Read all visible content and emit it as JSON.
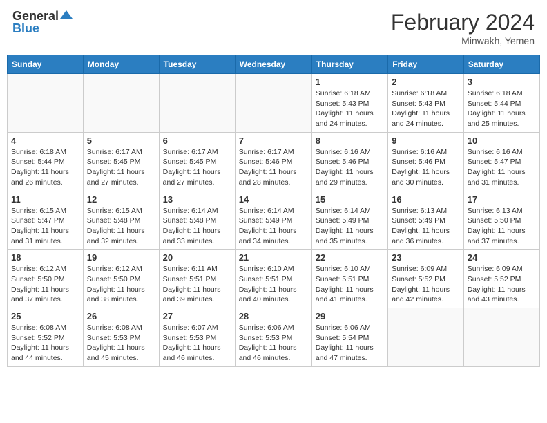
{
  "header": {
    "logo_general": "General",
    "logo_blue": "Blue",
    "month_year": "February 2024",
    "location": "Minwakh, Yemen"
  },
  "weekdays": [
    "Sunday",
    "Monday",
    "Tuesday",
    "Wednesday",
    "Thursday",
    "Friday",
    "Saturday"
  ],
  "weeks": [
    [
      {
        "day": "",
        "info": ""
      },
      {
        "day": "",
        "info": ""
      },
      {
        "day": "",
        "info": ""
      },
      {
        "day": "",
        "info": ""
      },
      {
        "day": "1",
        "info": "Sunrise: 6:18 AM\nSunset: 5:43 PM\nDaylight: 11 hours and 24 minutes."
      },
      {
        "day": "2",
        "info": "Sunrise: 6:18 AM\nSunset: 5:43 PM\nDaylight: 11 hours and 24 minutes."
      },
      {
        "day": "3",
        "info": "Sunrise: 6:18 AM\nSunset: 5:44 PM\nDaylight: 11 hours and 25 minutes."
      }
    ],
    [
      {
        "day": "4",
        "info": "Sunrise: 6:18 AM\nSunset: 5:44 PM\nDaylight: 11 hours and 26 minutes."
      },
      {
        "day": "5",
        "info": "Sunrise: 6:17 AM\nSunset: 5:45 PM\nDaylight: 11 hours and 27 minutes."
      },
      {
        "day": "6",
        "info": "Sunrise: 6:17 AM\nSunset: 5:45 PM\nDaylight: 11 hours and 27 minutes."
      },
      {
        "day": "7",
        "info": "Sunrise: 6:17 AM\nSunset: 5:46 PM\nDaylight: 11 hours and 28 minutes."
      },
      {
        "day": "8",
        "info": "Sunrise: 6:16 AM\nSunset: 5:46 PM\nDaylight: 11 hours and 29 minutes."
      },
      {
        "day": "9",
        "info": "Sunrise: 6:16 AM\nSunset: 5:46 PM\nDaylight: 11 hours and 30 minutes."
      },
      {
        "day": "10",
        "info": "Sunrise: 6:16 AM\nSunset: 5:47 PM\nDaylight: 11 hours and 31 minutes."
      }
    ],
    [
      {
        "day": "11",
        "info": "Sunrise: 6:15 AM\nSunset: 5:47 PM\nDaylight: 11 hours and 31 minutes."
      },
      {
        "day": "12",
        "info": "Sunrise: 6:15 AM\nSunset: 5:48 PM\nDaylight: 11 hours and 32 minutes."
      },
      {
        "day": "13",
        "info": "Sunrise: 6:14 AM\nSunset: 5:48 PM\nDaylight: 11 hours and 33 minutes."
      },
      {
        "day": "14",
        "info": "Sunrise: 6:14 AM\nSunset: 5:49 PM\nDaylight: 11 hours and 34 minutes."
      },
      {
        "day": "15",
        "info": "Sunrise: 6:14 AM\nSunset: 5:49 PM\nDaylight: 11 hours and 35 minutes."
      },
      {
        "day": "16",
        "info": "Sunrise: 6:13 AM\nSunset: 5:49 PM\nDaylight: 11 hours and 36 minutes."
      },
      {
        "day": "17",
        "info": "Sunrise: 6:13 AM\nSunset: 5:50 PM\nDaylight: 11 hours and 37 minutes."
      }
    ],
    [
      {
        "day": "18",
        "info": "Sunrise: 6:12 AM\nSunset: 5:50 PM\nDaylight: 11 hours and 37 minutes."
      },
      {
        "day": "19",
        "info": "Sunrise: 6:12 AM\nSunset: 5:50 PM\nDaylight: 11 hours and 38 minutes."
      },
      {
        "day": "20",
        "info": "Sunrise: 6:11 AM\nSunset: 5:51 PM\nDaylight: 11 hours and 39 minutes."
      },
      {
        "day": "21",
        "info": "Sunrise: 6:10 AM\nSunset: 5:51 PM\nDaylight: 11 hours and 40 minutes."
      },
      {
        "day": "22",
        "info": "Sunrise: 6:10 AM\nSunset: 5:51 PM\nDaylight: 11 hours and 41 minutes."
      },
      {
        "day": "23",
        "info": "Sunrise: 6:09 AM\nSunset: 5:52 PM\nDaylight: 11 hours and 42 minutes."
      },
      {
        "day": "24",
        "info": "Sunrise: 6:09 AM\nSunset: 5:52 PM\nDaylight: 11 hours and 43 minutes."
      }
    ],
    [
      {
        "day": "25",
        "info": "Sunrise: 6:08 AM\nSunset: 5:52 PM\nDaylight: 11 hours and 44 minutes."
      },
      {
        "day": "26",
        "info": "Sunrise: 6:08 AM\nSunset: 5:53 PM\nDaylight: 11 hours and 45 minutes."
      },
      {
        "day": "27",
        "info": "Sunrise: 6:07 AM\nSunset: 5:53 PM\nDaylight: 11 hours and 46 minutes."
      },
      {
        "day": "28",
        "info": "Sunrise: 6:06 AM\nSunset: 5:53 PM\nDaylight: 11 hours and 46 minutes."
      },
      {
        "day": "29",
        "info": "Sunrise: 6:06 AM\nSunset: 5:54 PM\nDaylight: 11 hours and 47 minutes."
      },
      {
        "day": "",
        "info": ""
      },
      {
        "day": "",
        "info": ""
      }
    ]
  ]
}
